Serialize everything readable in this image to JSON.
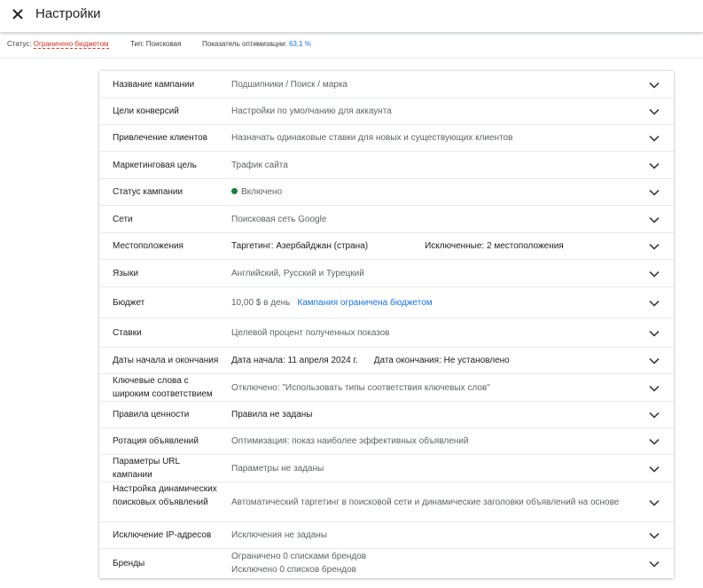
{
  "header": {
    "title": "Настройки",
    "close_icon": "close-icon"
  },
  "statusbar": {
    "status_label": "Статус:",
    "status_value": "Ограничено бюджетом",
    "type_label": "Тип:",
    "type_value": "Поисковая",
    "optimization_label": "Показатель оптимизации:",
    "optimization_value": "63,1 %"
  },
  "colors": {
    "accent": "#1a73e8",
    "warning": "#d93025",
    "enabled": "#188038",
    "divider": "#e8eaed"
  },
  "settings": {
    "campaign_name": {
      "label": "Название кампании",
      "value": "Подшипники / Поиск / марка"
    },
    "conversion_goals": {
      "label": "Цели конверсий",
      "value": "Настройки по умолчанию для аккаунта"
    },
    "customer_acquisition": {
      "label": "Привлечение клиентов",
      "value": "Назначать одинаковые ставки для новых и существующих клиентов"
    },
    "marketing_goal": {
      "label": "Маркетинговая цель",
      "value": "Трафик сайта"
    },
    "campaign_status": {
      "label": "Статус кампании",
      "value": "Включено"
    },
    "networks": {
      "label": "Сети",
      "value": "Поисковая сеть Google"
    },
    "locations": {
      "label": "Местоположения",
      "targeting": "Таргетинг: Азербайджан (страна)",
      "excluded": "Исключенные: 2 местоположения"
    },
    "languages": {
      "label": "Языки",
      "value": "Английский, Русский и Турецкий"
    },
    "budget": {
      "label": "Бюджет",
      "value": "10,00 $ в день",
      "link": "Кампания ограничена бюджетом"
    },
    "bids": {
      "label": "Ставки",
      "value": "Целевой процент полученных показов"
    },
    "dates": {
      "label": "Даты начала и окончания",
      "start": "Дата начала: 11 апреля 2024 г.",
      "end": "Дата окончания: Не установлено"
    },
    "broad_match": {
      "label": "Ключевые слова с широким соответствием",
      "value": "Отключено: \"Использовать типы соответствия ключевых слов\""
    },
    "value_rules": {
      "label": "Правила ценности",
      "value": "Правила не заданы"
    },
    "ad_rotation": {
      "label": "Ротация объявлений",
      "value": "Оптимизация: показ наиболее эффективных объявлений"
    },
    "url_params": {
      "label": "Параметры URL кампании",
      "value": "Параметры не заданы"
    },
    "dsa": {
      "label": "Настройка динамических поисковых объявлений",
      "value": "Автоматический таргетинг в поисковой сети и динамические заголовки объявлений на основе"
    },
    "ip_exclusion": {
      "label": "Исключение IP-адресов",
      "value": "Исключения не заданы"
    },
    "brands": {
      "label": "Бренды",
      "limited": "Ограничено 0 списками брендов",
      "excluded": "Исключено 0 списков брендов"
    }
  },
  "icons": {
    "row_expand": "chevron-down-icon",
    "status_dot": "status-dot-icon"
  }
}
